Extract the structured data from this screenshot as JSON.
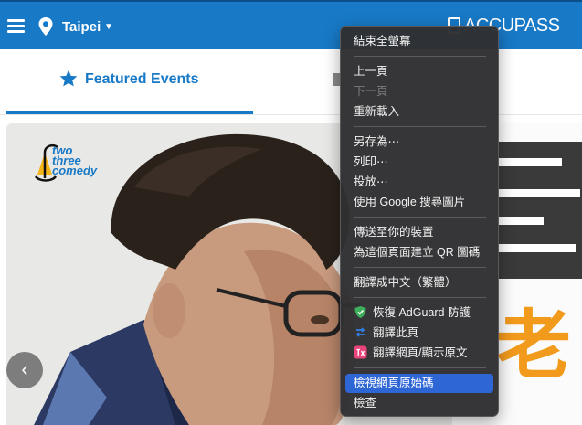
{
  "header": {
    "city": "Taipei",
    "brand": "ACCUPASS"
  },
  "tabs": {
    "featured": "Featured Events"
  },
  "banner": {
    "logo_text": [
      "two",
      "three",
      "comedy"
    ],
    "side_text": "老"
  },
  "context_menu": {
    "items": [
      {
        "label": "結束全螢幕",
        "enabled": true
      },
      {
        "label": "上一頁",
        "enabled": true
      },
      {
        "label": "下一頁",
        "enabled": false
      },
      {
        "label": "重新載入",
        "enabled": true
      },
      {
        "label": "另存為⋯",
        "enabled": true
      },
      {
        "label": "列印⋯",
        "enabled": true
      },
      {
        "label": "投放⋯",
        "enabled": true
      },
      {
        "label": "使用 Google 搜尋圖片",
        "enabled": true
      },
      {
        "label": "傳送至你的裝置",
        "enabled": true
      },
      {
        "label": "為這個頁面建立 QR 圖碼",
        "enabled": true
      },
      {
        "label": "翻譯成中文（繁體）",
        "enabled": true
      },
      {
        "label": "恢復 AdGuard 防護",
        "enabled": true
      },
      {
        "label": "翻譯此頁",
        "enabled": true
      },
      {
        "label": "翻譯網頁/顯示原文",
        "enabled": true
      },
      {
        "label": "檢視網頁原始碼",
        "enabled": true,
        "highlighted": true
      },
      {
        "label": "檢查",
        "enabled": true
      }
    ]
  },
  "colors": {
    "brand_blue": "#1879c6",
    "menu_bg": "#303032",
    "menu_highlight": "#2f66d6",
    "adguard_green": "#3fae5c",
    "translate_blue": "#2f7fe8",
    "translate_pink": "#e8457a"
  }
}
